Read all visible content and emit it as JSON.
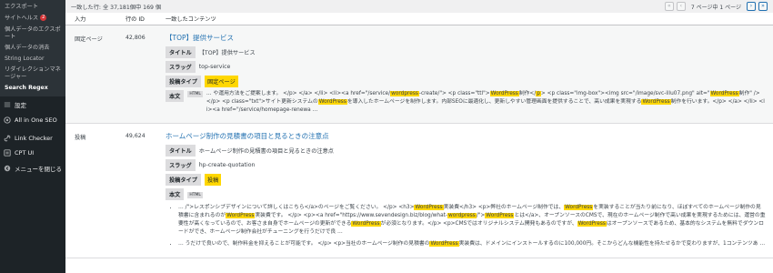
{
  "sidebar": {
    "sub_items": [
      {
        "label": "エクスポート"
      },
      {
        "label": "サイトヘルス",
        "badge": "2"
      },
      {
        "label": "個人データのエクスポート"
      },
      {
        "label": "個人データの消去"
      },
      {
        "label": "String Locator"
      },
      {
        "label": "リダイレクションマネージャー"
      },
      {
        "label": "Search Regex"
      }
    ],
    "main_items": [
      {
        "label": "設定",
        "icon": "settings-icon"
      },
      {
        "label": "All in One SEO",
        "icon": "aioseo-icon"
      },
      {
        "label": "Link Checker",
        "icon": "link-checker-icon"
      },
      {
        "label": "CPT UI",
        "icon": "cptui-icon"
      },
      {
        "label": "メニューを閉じる",
        "icon": "collapse-menu-icon"
      }
    ]
  },
  "topbar": {
    "results": "一致した行: 全 37,181個中 169 個",
    "page_text": "7 ページ中 1 ページ",
    "first_btn": "«",
    "prev_btn": "‹",
    "next_btn": "›",
    "last_btn": "»"
  },
  "table": {
    "headers": {
      "type": "入力",
      "id": "行の ID",
      "content": "一致したコンテンツ"
    },
    "labels": {
      "title": "タイトル",
      "slug": "スラッグ",
      "post_type": "投稿タイプ",
      "body": "本文",
      "html": "HTML"
    },
    "rows": [
      {
        "type": "固定ページ",
        "id": "42,806",
        "title": "【TOP】提供サービス",
        "field_title": "【TOP】提供サービス",
        "slug": "top-service",
        "post_type": "固定ページ",
        "body_parts": [
          {
            "t": "… や運用方法をご提案します。 </p> </a> </li> <li><a href=\"/service/"
          },
          {
            "t": "wordpress",
            "h": 1
          },
          {
            "t": "-create/\"> <p class=\"ttl\">"
          },
          {
            "t": "WordPress",
            "h": 1
          },
          {
            "t": "制作</"
          },
          {
            "t": "p",
            "h": 1
          },
          {
            "t": "> <p class=\"img-box\"><img src=\"/image/svc-illu07.png\" alt=\""
          },
          {
            "t": "WordPress",
            "h": 1
          },
          {
            "t": "制作\" /></p> <p class=\"txt\">サイト更新システムの"
          },
          {
            "t": "WordPress",
            "h": 1
          },
          {
            "t": "を導入したホームページを制作します。内部SEOに最適化し、更新しやすい管理画面を提供することで、高い成果を実現する"
          },
          {
            "t": "WordPress",
            "h": 1
          },
          {
            "t": "制作を行います。</p> </a> </li> <li><a href=\"/service/homepage-renewa …"
          }
        ]
      },
      {
        "type": "投稿",
        "id": "49,624",
        "title": "ホームページ制作の見積書の項目と見るときの注意点",
        "field_title": "ホームページ制作の見積書の項目と見るときの注意点",
        "slug": "hp-create-quotation",
        "post_type": "投稿",
        "matches": [
          [
            {
              "t": "… /\">レスポンシブデザインについて詳しくはこちら</a>のページをご覧ください。 </p> <h3>"
            },
            {
              "t": "WordPress",
              "h": 1
            },
            {
              "t": "実装費</h3> <p>弊社のホームページ制作では、"
            },
            {
              "t": "WordPress",
              "h": 1
            },
            {
              "t": "を実装することが当たり前になり、ほぼすべてのホームページ制作の見積書に含まれるのが"
            },
            {
              "t": "WordPress",
              "h": 1
            },
            {
              "t": "実装費です。 </p> <p><a href=\"https://www.sevendesign.biz/blog/what-"
            },
            {
              "t": "wordpress",
              "h": 1
            },
            {
              "t": "/\">"
            },
            {
              "t": "WordPress",
              "h": 1
            },
            {
              "t": "とは</a>、オープンソースのCMSで、現在のホームページ制作で高い成果を実現するためには、運営の重要性が高くなっているので、お客さま自身でホームページの更新ができる"
            },
            {
              "t": "WordPress",
              "h": 1
            },
            {
              "t": "が必須となります。</p> <p>CMSではオリジナルシステム開発もあるのですが、"
            },
            {
              "t": "WordPress",
              "h": 1
            },
            {
              "t": "はオープンソースであるため、基本的なシステムを無料でダウンロードができ、ホームページ制作会社がチューニングを行うだけで良 …"
            }
          ],
          [
            {
              "t": "… うだけで良いので、制作料金を抑えることが可能です。 </p> <p>当社のホームページ制作の見積書の"
            },
            {
              "t": "WordPress",
              "h": 1
            },
            {
              "t": "実装費は、ドメインにインストールするのに100,000円。そこからどんな機能性を持たせるかで変わりますが、1コンテンツあ …"
            }
          ]
        ]
      }
    ]
  }
}
